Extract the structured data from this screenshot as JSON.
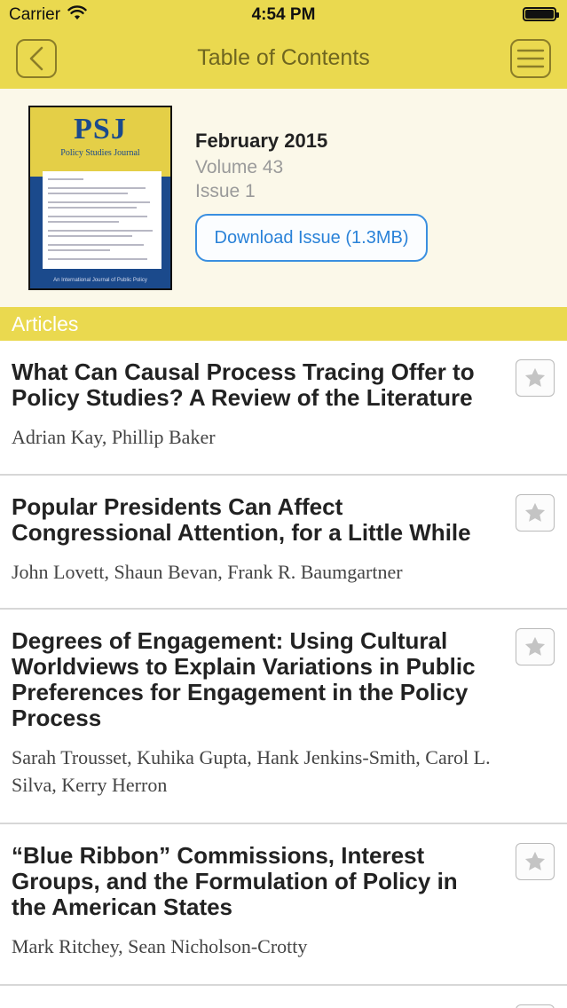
{
  "status_bar": {
    "carrier": "Carrier",
    "time": "4:54 PM"
  },
  "nav": {
    "title": "Table of Contents",
    "back_icon": "chevron-left-icon",
    "menu_icon": "hamburger-menu-icon"
  },
  "issue": {
    "cover": {
      "logo": "PSJ",
      "subtitle": "Policy Studies Journal",
      "footer": "An International Journal of Public Policy"
    },
    "date": "February 2015",
    "volume": "Volume 43",
    "number": "Issue 1",
    "download_label": "Download Issue (1.3MB)"
  },
  "section": {
    "label": "Articles"
  },
  "articles": [
    {
      "title": "What Can Causal Process Tracing Offer to Policy Studies? A Review of the Literature",
      "authors": "Adrian Kay, Phillip Baker"
    },
    {
      "title": "Popular Presidents Can Affect Congressional Attention, for a Little While",
      "authors": "John Lovett, Shaun Bevan, Frank R. Baumgartner"
    },
    {
      "title": "Degrees of Engagement: Using Cultural Worldviews to Explain Variations in Public Preferences for Engagement in the Policy Process",
      "authors": "Sarah Trousset, Kuhika Gupta, Hank Jenkins-Smith, Carol L. Silva, Kerry Herron"
    },
    {
      "title": "“Blue Ribbon” Commissions, Interest Groups, and the Formulation of Policy in the American States",
      "authors": "Mark Ritchey, Sean Nicholson-Crotty"
    },
    {
      "title": "",
      "authors": ""
    }
  ],
  "colors": {
    "accent_yellow": "#ead94f",
    "link_blue": "#2a82d8",
    "nav_title": "#6f6620"
  }
}
